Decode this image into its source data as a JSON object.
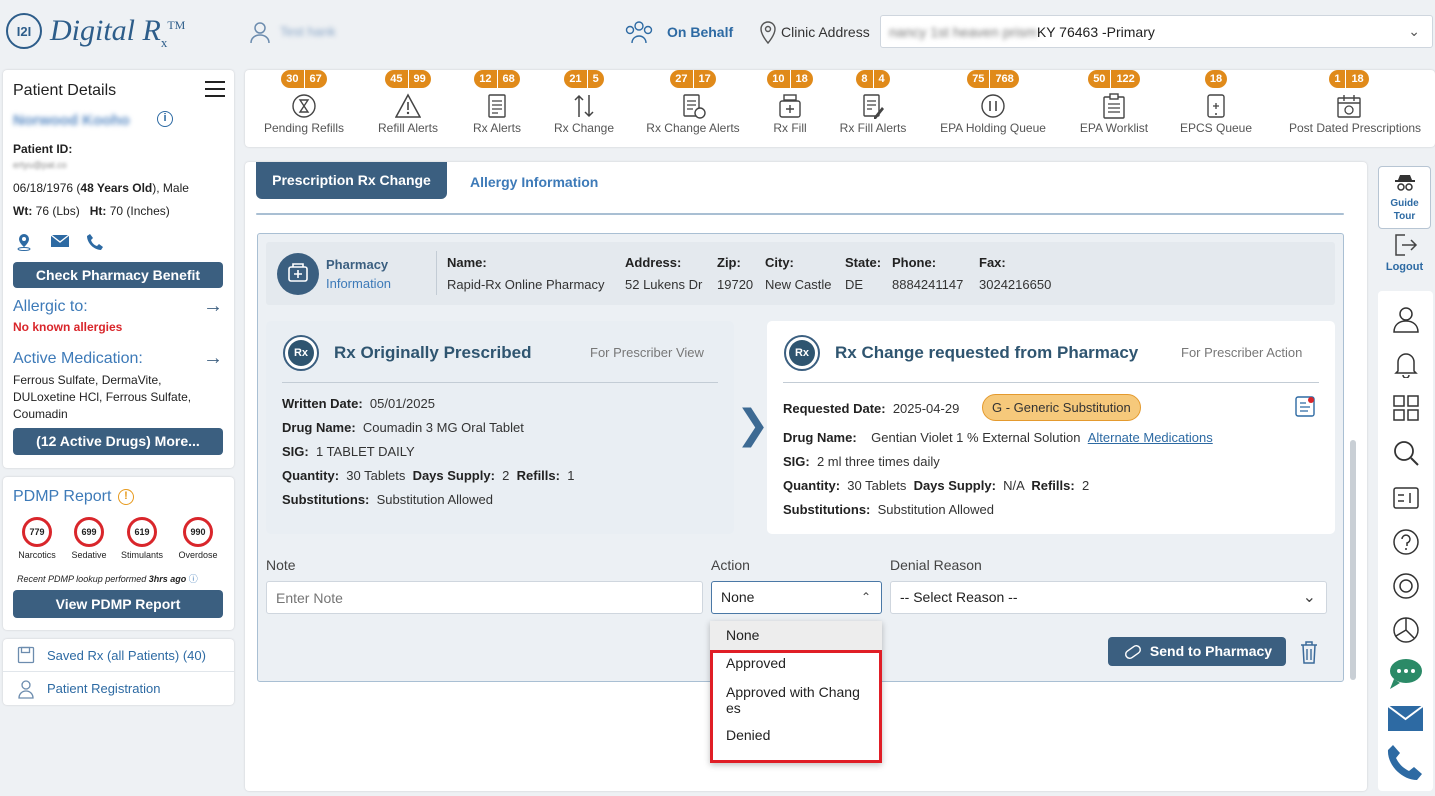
{
  "header": {
    "logo_mark": "I2I",
    "logo_text": "Digital R",
    "logo_sub": "x",
    "logo_tm": "TM",
    "user_name": "Test hank",
    "on_behalf": "On Behalf",
    "clinic_label": "Clinic Address",
    "clinic_value_blur": "nancy 1st heaven prism",
    "clinic_value": "KY 76463 -Primary"
  },
  "patient": {
    "title": "Patient Details",
    "name": "Norwood Kooho",
    "id_label": "Patient ID:",
    "id_value": "ertyu@pat.co",
    "dob": "06/18/1976",
    "age": "48 Years Old",
    "gender": ", Male",
    "wt_label": "Wt:",
    "wt_value": "76 (Lbs)",
    "ht_label": "Ht:",
    "ht_value": "70 (Inches)",
    "check_pharmacy": "Check Pharmacy Benefit",
    "allergic_label": "Allergic to:",
    "allergy_value": "No known allergies",
    "active_med_label": "Active Medication:",
    "active_meds": "Ferrous Sulfate, DermaVite, DULoxetine HCl, Ferrous Sulfate, Coumadin",
    "more_button": "(12 Active Drugs) More..."
  },
  "pdmp": {
    "title": "PDMP Report",
    "gauges": [
      {
        "value": "779",
        "label": "Narcotics"
      },
      {
        "value": "699",
        "label": "Sedative"
      },
      {
        "value": "619",
        "label": "Stimulants"
      },
      {
        "value": "990",
        "label": "Overdose"
      }
    ],
    "note_prefix": "Recent PDMP lookup performed ",
    "note_time": "3hrs ago",
    "button": "View PDMP Report"
  },
  "links": {
    "saved_rx": "Saved Rx (all Patients) (40)",
    "registration": "Patient Registration"
  },
  "toolbar": [
    {
      "label": "Pending Refills",
      "badges": [
        "30",
        "67"
      ],
      "icon": "hourglass-icon"
    },
    {
      "label": "Refill Alerts",
      "badges": [
        "45",
        "99"
      ],
      "icon": "warning-icon"
    },
    {
      "label": "Rx Alerts",
      "badges": [
        "12",
        "68"
      ],
      "icon": "document-icon"
    },
    {
      "label": "Rx Change",
      "badges": [
        "21",
        "5"
      ],
      "icon": "swap-icon"
    },
    {
      "label": "Rx Change Alerts",
      "badges": [
        "27",
        "17"
      ],
      "icon": "doc-alert-icon"
    },
    {
      "label": "Rx Fill",
      "badges": [
        "10",
        "18"
      ],
      "icon": "pill-bottle-icon"
    },
    {
      "label": "Rx Fill Alerts",
      "badges": [
        "8",
        "4"
      ],
      "icon": "doc-edit-icon"
    },
    {
      "label": "EPA Holding Queue",
      "badges": [
        "75",
        "768"
      ],
      "icon": "pause-icon"
    },
    {
      "label": "EPA Worklist",
      "badges": [
        "50",
        "122"
      ],
      "icon": "clipboard-icon"
    },
    {
      "label": "EPCS Queue",
      "badges": [
        "18"
      ],
      "icon": "tablet-icon"
    },
    {
      "label": "Post Dated Prescriptions",
      "badges": [
        "1",
        "18"
      ],
      "icon": "calendar-icon"
    }
  ],
  "tabs": {
    "active": "Prescription Rx Change",
    "other": "Allergy Information"
  },
  "pharmacy": {
    "title1": "Pharmacy",
    "title2": "Information",
    "name_label": "Name:",
    "name": "Rapid-Rx Online Pharmacy",
    "address_label": "Address:",
    "address": "52 Lukens Dr",
    "zip_label": "Zip:",
    "zip": "19720",
    "city_label": "City:",
    "city": "New Castle",
    "state_label": "State:",
    "state": "DE",
    "phone_label": "Phone:",
    "phone": "8884241147",
    "fax_label": "Fax:",
    "fax": "3024216650"
  },
  "original": {
    "title": "Rx Originally Prescribed",
    "subtitle": "For Prescriber View",
    "written_label": "Written Date:",
    "written": "05/01/2025",
    "drug_label": "Drug Name:",
    "drug": "Coumadin 3 MG Oral Tablet",
    "sig_label": "SIG:",
    "sig": "1 TABLET DAILY",
    "qty_label": "Quantity:",
    "qty": "30 Tablets",
    "days_label": "Days Supply:",
    "days": "2",
    "refills_label": "Refills:",
    "refills": "1",
    "subs_label": "Substitutions:",
    "subs": "Substitution Allowed"
  },
  "change": {
    "title": "Rx Change requested from Pharmacy",
    "subtitle": "For Prescriber Action",
    "requested_label": "Requested Date:",
    "requested": "2025-04-29",
    "badge": "G - Generic Substitution",
    "drug_label": "Drug Name:",
    "drug": "Gentian Violet 1 % External Solution",
    "alt_link": "Alternate Medications",
    "sig_label": "SIG:",
    "sig": "2 ml three times daily",
    "qty_label": "Quantity:",
    "qty": "30 Tablets",
    "days_label": "Days Supply:",
    "days": "N/A",
    "refills_label": "Refills:",
    "refills": "2",
    "subs_label": "Substitutions:",
    "subs": "Substitution Allowed"
  },
  "form": {
    "note_label": "Note",
    "note_placeholder": "Enter Note",
    "action_label": "Action",
    "action_value": "None",
    "deny_label": "Denial Reason",
    "deny_value": "-- Select Reason --",
    "send_button": "Send to Pharmacy"
  },
  "dropdown": {
    "options": [
      "None",
      "Approved",
      "Approved with Chang",
      "es",
      "Denied"
    ]
  },
  "right": {
    "guide": "Guide",
    "tour": "Tour",
    "logout": "Logout"
  },
  "colors": {
    "primary": "#3b5f80",
    "accent": "#e08a1a",
    "link": "#2d6aa3",
    "alert": "#d9262b"
  }
}
